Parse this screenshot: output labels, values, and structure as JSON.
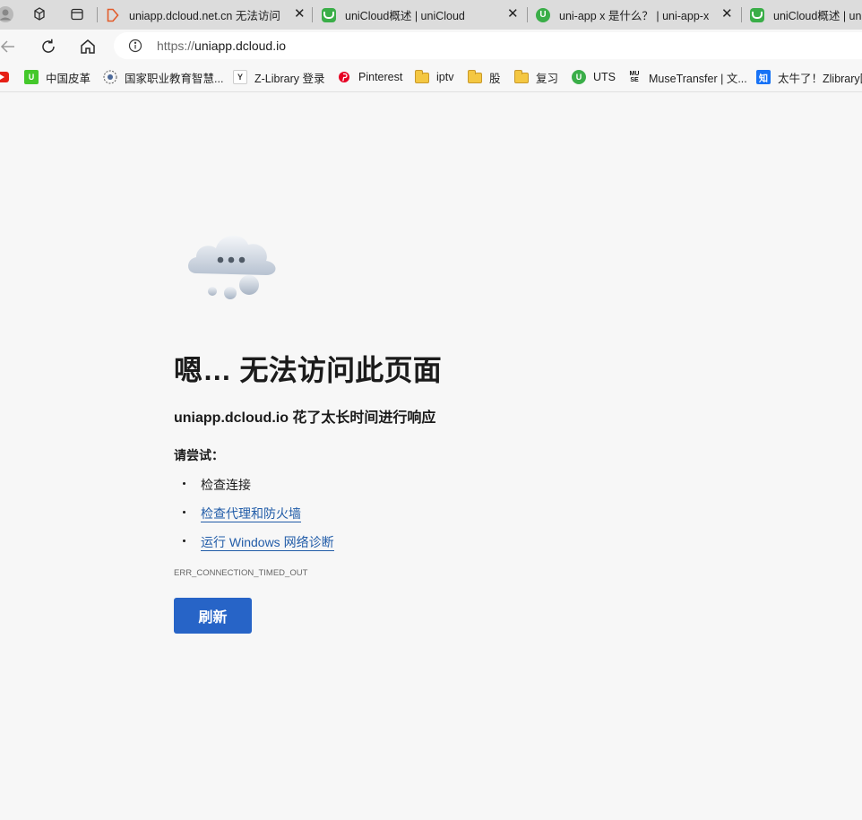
{
  "tabs": [
    {
      "title": "uniapp.dcloud.net.cn 无法访问 -",
      "favicon": "broken-page-icon"
    },
    {
      "title": "uniCloud概述 | uniCloud",
      "favicon": "unicloud-icon"
    },
    {
      "title": "uni-app x 是什么？ | uni-app-x",
      "favicon": "uniapp-icon"
    },
    {
      "title": "uniCloud概述 | uniCloud",
      "favicon": "unicloud-icon"
    }
  ],
  "address": {
    "protocol": "https://",
    "host": "uniapp.dcloud.io"
  },
  "favorites": [
    {
      "label": "中国皮革",
      "icon": "green-u-icon"
    },
    {
      "label": "国家职业教育智慧...",
      "icon": "crest-icon"
    },
    {
      "label": "Z-Library 登录",
      "icon": "zlibrary-icon"
    },
    {
      "label": "Pinterest",
      "icon": "pinterest-icon"
    },
    {
      "label": "iptv",
      "icon": "folder-icon"
    },
    {
      "label": "股",
      "icon": "folder-icon"
    },
    {
      "label": "复习",
      "icon": "folder-icon"
    },
    {
      "label": "UTS",
      "icon": "uniapp-icon"
    },
    {
      "label": "MuseTransfer | 文...",
      "icon": "muse-icon"
    },
    {
      "label": "太牛了！Zlibrary国",
      "icon": "zhihu-icon"
    }
  ],
  "favicon_badges": {
    "muse_top": "MU",
    "muse_bottom": "SE",
    "zhihu": "知",
    "zlib": "Y",
    "green_u": "U"
  },
  "error": {
    "heading": "嗯… 无法访问此页面",
    "subheading": "uniapp.dcloud.io 花了太长时间进行响应",
    "try_label": "请尝试：",
    "suggestions": [
      {
        "text": "检查连接",
        "link": false
      },
      {
        "text": "检查代理和防火墙",
        "link": true
      },
      {
        "text": "运行 Windows 网络诊断",
        "link": true
      }
    ],
    "code": "ERR_CONNECTION_TIMED_OUT",
    "button": "刷新"
  },
  "colors": {
    "accent": "#2764c7",
    "link": "#215ca8",
    "unicloud_green": "#3aae48",
    "tab_strip": "#dcdcdc"
  }
}
